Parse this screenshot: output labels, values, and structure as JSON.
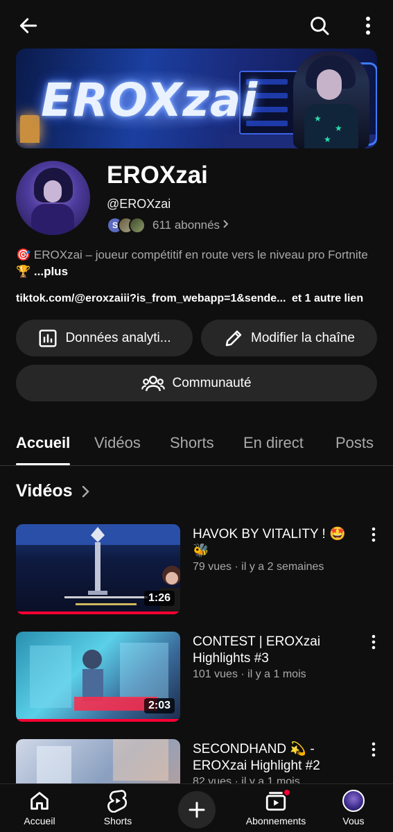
{
  "channel": {
    "banner_text": "EROXzai",
    "name": "EROXzai",
    "handle": "@EROXzai",
    "subscriber_avatar_initial": "S",
    "subscribers": "611 abonnés",
    "description": "🎯 EROXzai – joueur compétitif en route vers le niveau pro Fortnite 🏆",
    "description_more": "...plus",
    "link": "tiktok.com/@eroxzaiii?is_from_webapp=1&sende...",
    "link_extra": "et 1 autre lien"
  },
  "actions": {
    "analytics_label": "Données analyti...",
    "edit_label": "Modifier la chaîne",
    "community_label": "Communauté"
  },
  "tabs": [
    {
      "label": "Accueil"
    },
    {
      "label": "Vidéos"
    },
    {
      "label": "Shorts"
    },
    {
      "label": "En direct"
    },
    {
      "label": "Posts"
    }
  ],
  "section": {
    "title": "Vidéos"
  },
  "videos": [
    {
      "title": "HAVOK BY VITALITY ! 🤩🐝",
      "meta": "79 vues · il y a 2 semaines",
      "duration": "1:26"
    },
    {
      "title": "CONTEST | EROXzai Highlights #3",
      "meta": "101 vues · il y a 1 mois",
      "duration": "2:03"
    },
    {
      "title": "SECONDHAND 💫 - EROXzai Highlight #2",
      "meta": "82 vues · il y a 1 mois",
      "duration": ""
    }
  ],
  "nav": {
    "home": "Accueil",
    "shorts": "Shorts",
    "subscriptions": "Abonnements",
    "you": "Vous"
  },
  "icons": {
    "back": "arrow-left-icon",
    "search": "search-icon",
    "more": "more-vert-icon"
  },
  "colors": {
    "background": "#0f0f0f",
    "accent": "#ff0033",
    "pill": "#272727"
  }
}
